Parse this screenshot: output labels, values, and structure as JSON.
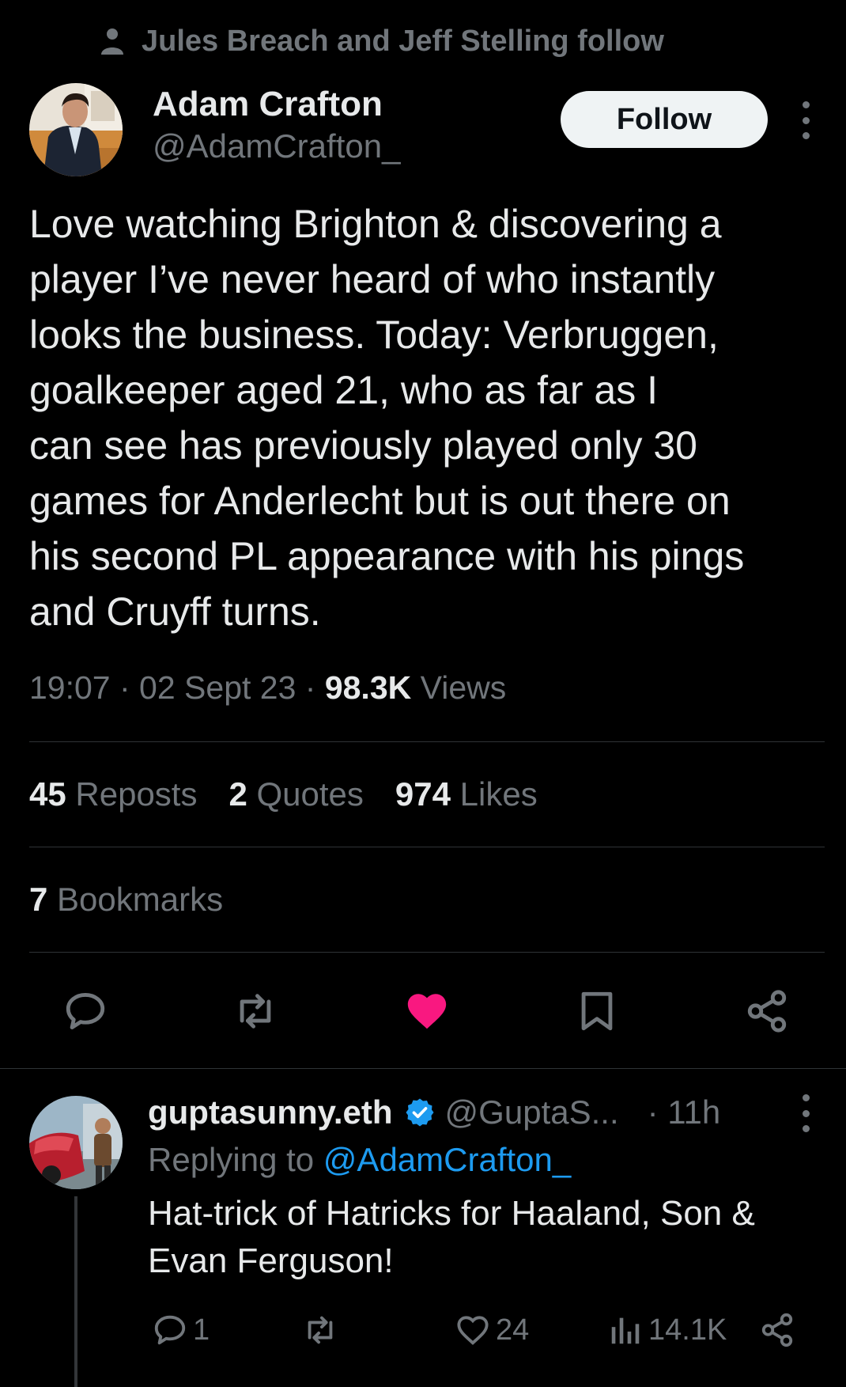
{
  "social_context": {
    "text": "Jules Breach and Jeff Stelling follow",
    "icon": "person-icon"
  },
  "author": {
    "name": "Adam Crafton",
    "handle": "@AdamCrafton_"
  },
  "follow_button": {
    "label": "Follow"
  },
  "tweet": {
    "lines": [
      "Love watching Brighton & discovering a",
      "player I’ve never heard of who instantly",
      "looks the business. Today: Verbruggen,",
      "goalkeeper aged 21, who as far as I",
      "can see has previously played only 30",
      "games for Anderlecht but is out there on",
      "his second PL appearance with his pings",
      "and Cruyff turns."
    ]
  },
  "meta": {
    "time": "19:07",
    "date": "02 Sept 23",
    "views_count": "98.3K",
    "views_label": "Views"
  },
  "stats": {
    "reposts_count": "45",
    "reposts_label": "Reposts",
    "quotes_count": "2",
    "quotes_label": "Quotes",
    "likes_count": "974",
    "likes_label": "Likes",
    "bookmarks_count": "7",
    "bookmarks_label": "Bookmarks"
  },
  "actions": {
    "icons": [
      "reply-icon",
      "repost-icon",
      "like-icon",
      "bookmark-icon",
      "share-icon"
    ],
    "liked": true,
    "like_color": "#f91880"
  },
  "reply": {
    "name": "guptasunny.eth",
    "handle": "@GuptaS...",
    "time": "· 11h",
    "replying_prefix": "Replying to",
    "replying_to": "@AdamCrafton_",
    "lines": [
      "Hat-trick of Hatricks for Haaland, Son &",
      "Evan Ferguson!"
    ],
    "replies": "1",
    "likes": "24",
    "views": "14.1K",
    "verified_color": "#1d9bf0"
  },
  "colors": {
    "background": "#000000",
    "text": "#e7e9ea",
    "secondary": "#71767b",
    "accent": "#1d9bf0"
  }
}
